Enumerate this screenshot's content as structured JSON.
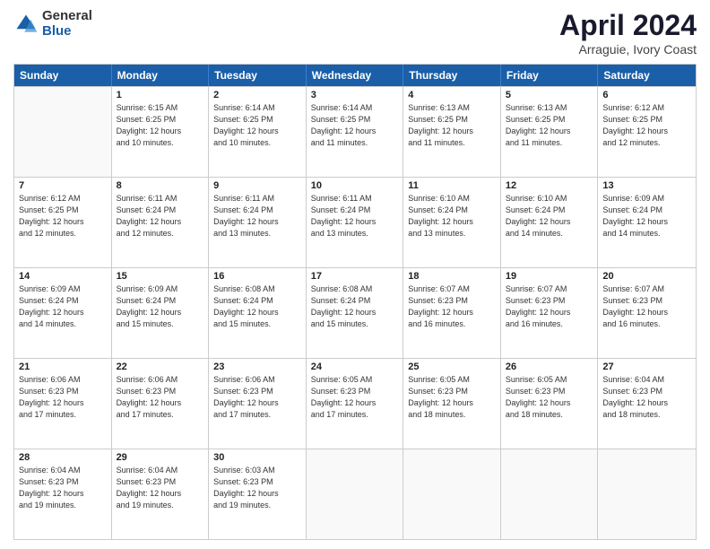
{
  "logo": {
    "general": "General",
    "blue": "Blue"
  },
  "header": {
    "month": "April 2024",
    "location": "Arraguie, Ivory Coast"
  },
  "weekdays": [
    "Sunday",
    "Monday",
    "Tuesday",
    "Wednesday",
    "Thursday",
    "Friday",
    "Saturday"
  ],
  "rows": [
    [
      {
        "day": "",
        "info": "",
        "empty": true
      },
      {
        "day": "1",
        "info": "Sunrise: 6:15 AM\nSunset: 6:25 PM\nDaylight: 12 hours\nand 10 minutes.",
        "empty": false
      },
      {
        "day": "2",
        "info": "Sunrise: 6:14 AM\nSunset: 6:25 PM\nDaylight: 12 hours\nand 10 minutes.",
        "empty": false
      },
      {
        "day": "3",
        "info": "Sunrise: 6:14 AM\nSunset: 6:25 PM\nDaylight: 12 hours\nand 11 minutes.",
        "empty": false
      },
      {
        "day": "4",
        "info": "Sunrise: 6:13 AM\nSunset: 6:25 PM\nDaylight: 12 hours\nand 11 minutes.",
        "empty": false
      },
      {
        "day": "5",
        "info": "Sunrise: 6:13 AM\nSunset: 6:25 PM\nDaylight: 12 hours\nand 11 minutes.",
        "empty": false
      },
      {
        "day": "6",
        "info": "Sunrise: 6:12 AM\nSunset: 6:25 PM\nDaylight: 12 hours\nand 12 minutes.",
        "empty": false
      }
    ],
    [
      {
        "day": "7",
        "info": "Sunrise: 6:12 AM\nSunset: 6:25 PM\nDaylight: 12 hours\nand 12 minutes.",
        "empty": false
      },
      {
        "day": "8",
        "info": "Sunrise: 6:11 AM\nSunset: 6:24 PM\nDaylight: 12 hours\nand 12 minutes.",
        "empty": false
      },
      {
        "day": "9",
        "info": "Sunrise: 6:11 AM\nSunset: 6:24 PM\nDaylight: 12 hours\nand 13 minutes.",
        "empty": false
      },
      {
        "day": "10",
        "info": "Sunrise: 6:11 AM\nSunset: 6:24 PM\nDaylight: 12 hours\nand 13 minutes.",
        "empty": false
      },
      {
        "day": "11",
        "info": "Sunrise: 6:10 AM\nSunset: 6:24 PM\nDaylight: 12 hours\nand 13 minutes.",
        "empty": false
      },
      {
        "day": "12",
        "info": "Sunrise: 6:10 AM\nSunset: 6:24 PM\nDaylight: 12 hours\nand 14 minutes.",
        "empty": false
      },
      {
        "day": "13",
        "info": "Sunrise: 6:09 AM\nSunset: 6:24 PM\nDaylight: 12 hours\nand 14 minutes.",
        "empty": false
      }
    ],
    [
      {
        "day": "14",
        "info": "Sunrise: 6:09 AM\nSunset: 6:24 PM\nDaylight: 12 hours\nand 14 minutes.",
        "empty": false
      },
      {
        "day": "15",
        "info": "Sunrise: 6:09 AM\nSunset: 6:24 PM\nDaylight: 12 hours\nand 15 minutes.",
        "empty": false
      },
      {
        "day": "16",
        "info": "Sunrise: 6:08 AM\nSunset: 6:24 PM\nDaylight: 12 hours\nand 15 minutes.",
        "empty": false
      },
      {
        "day": "17",
        "info": "Sunrise: 6:08 AM\nSunset: 6:24 PM\nDaylight: 12 hours\nand 15 minutes.",
        "empty": false
      },
      {
        "day": "18",
        "info": "Sunrise: 6:07 AM\nSunset: 6:23 PM\nDaylight: 12 hours\nand 16 minutes.",
        "empty": false
      },
      {
        "day": "19",
        "info": "Sunrise: 6:07 AM\nSunset: 6:23 PM\nDaylight: 12 hours\nand 16 minutes.",
        "empty": false
      },
      {
        "day": "20",
        "info": "Sunrise: 6:07 AM\nSunset: 6:23 PM\nDaylight: 12 hours\nand 16 minutes.",
        "empty": false
      }
    ],
    [
      {
        "day": "21",
        "info": "Sunrise: 6:06 AM\nSunset: 6:23 PM\nDaylight: 12 hours\nand 17 minutes.",
        "empty": false
      },
      {
        "day": "22",
        "info": "Sunrise: 6:06 AM\nSunset: 6:23 PM\nDaylight: 12 hours\nand 17 minutes.",
        "empty": false
      },
      {
        "day": "23",
        "info": "Sunrise: 6:06 AM\nSunset: 6:23 PM\nDaylight: 12 hours\nand 17 minutes.",
        "empty": false
      },
      {
        "day": "24",
        "info": "Sunrise: 6:05 AM\nSunset: 6:23 PM\nDaylight: 12 hours\nand 17 minutes.",
        "empty": false
      },
      {
        "day": "25",
        "info": "Sunrise: 6:05 AM\nSunset: 6:23 PM\nDaylight: 12 hours\nand 18 minutes.",
        "empty": false
      },
      {
        "day": "26",
        "info": "Sunrise: 6:05 AM\nSunset: 6:23 PM\nDaylight: 12 hours\nand 18 minutes.",
        "empty": false
      },
      {
        "day": "27",
        "info": "Sunrise: 6:04 AM\nSunset: 6:23 PM\nDaylight: 12 hours\nand 18 minutes.",
        "empty": false
      }
    ],
    [
      {
        "day": "28",
        "info": "Sunrise: 6:04 AM\nSunset: 6:23 PM\nDaylight: 12 hours\nand 19 minutes.",
        "empty": false
      },
      {
        "day": "29",
        "info": "Sunrise: 6:04 AM\nSunset: 6:23 PM\nDaylight: 12 hours\nand 19 minutes.",
        "empty": false
      },
      {
        "day": "30",
        "info": "Sunrise: 6:03 AM\nSunset: 6:23 PM\nDaylight: 12 hours\nand 19 minutes.",
        "empty": false
      },
      {
        "day": "",
        "info": "",
        "empty": true
      },
      {
        "day": "",
        "info": "",
        "empty": true
      },
      {
        "day": "",
        "info": "",
        "empty": true
      },
      {
        "day": "",
        "info": "",
        "empty": true
      }
    ]
  ]
}
